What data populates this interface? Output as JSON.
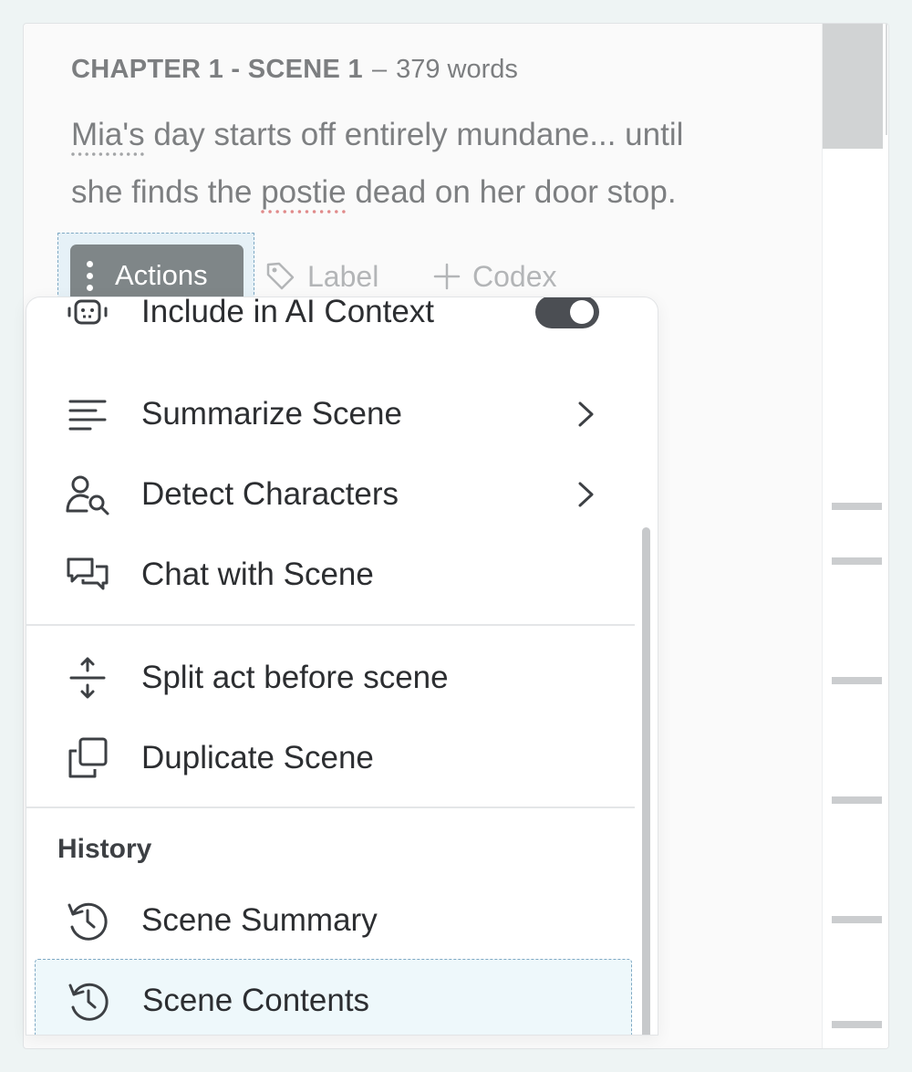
{
  "scene": {
    "chapter_label": "CHAPTER 1 - SCENE 1",
    "separator": "–",
    "word_count": "379 words",
    "summary_word_1": "Mia's",
    "summary_rest_1": " day starts off entirely mundane... until",
    "summary_pre_2": "she finds the ",
    "summary_err_word": "postie",
    "summary_rest_2": " dead on her door stop."
  },
  "toolbar": {
    "actions_label": "Actions",
    "label_label": "Label",
    "codex_label": "Codex"
  },
  "menu": {
    "items": [
      {
        "label": "Include in AI Context",
        "icon": "robot-icon",
        "toggle": true
      },
      {
        "label": "Summarize Scene",
        "icon": "text-lines-icon",
        "submenu": true
      },
      {
        "label": "Detect Characters",
        "icon": "user-search-icon",
        "submenu": true
      },
      {
        "label": "Chat with Scene",
        "icon": "chat-bubbles-icon"
      },
      {
        "label": "Split act before scene",
        "icon": "split-arrows-icon"
      },
      {
        "label": "Duplicate Scene",
        "icon": "duplicate-icon"
      }
    ],
    "history_heading": "History",
    "history_items": [
      {
        "label": "Scene Summary",
        "icon": "history-icon"
      },
      {
        "label": "Scene Contents",
        "icon": "history-icon",
        "highlighted": true
      }
    ]
  },
  "colors": {
    "accent": "#7f8688",
    "highlight_bg": "#eef8fb",
    "toggle_on": "#4b4e53"
  }
}
